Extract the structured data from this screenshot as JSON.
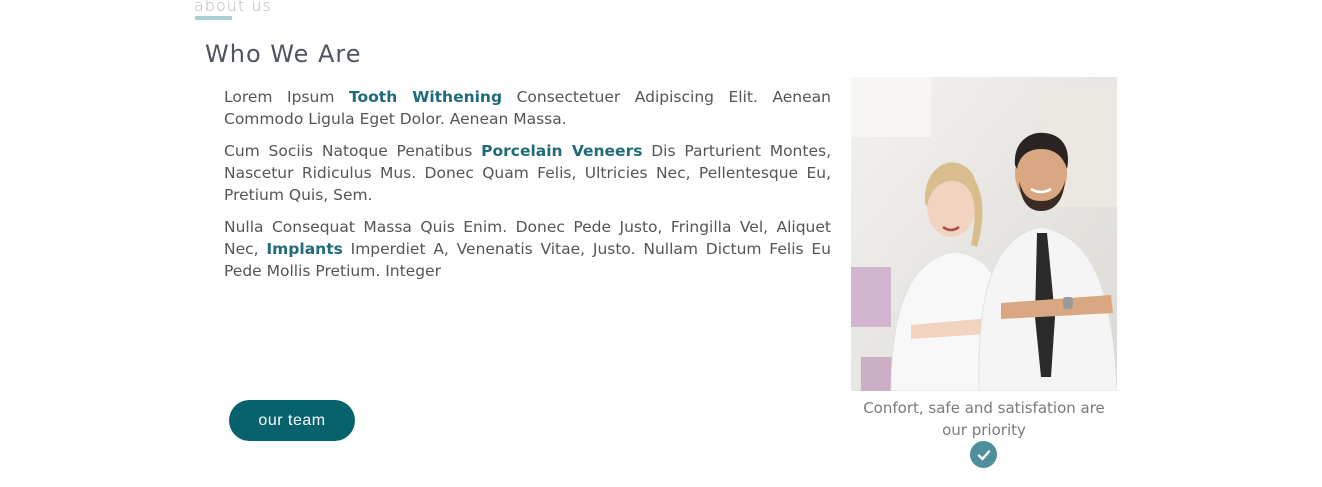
{
  "section": {
    "eyebrow": "about us",
    "title": "Who We Are"
  },
  "paragraphs": [
    {
      "before": "Lorem Ipsum ",
      "keyword": "Tooth Withening",
      "after": " Consectetuer Adipiscing Elit. Aenean Commodo Ligula Eget Dolor. Aenean Massa."
    },
    {
      "before": "Cum Sociis Natoque Penatibus ",
      "keyword": "Porcelain Veneers",
      "after": " Dis Parturient Montes, Nascetur Ridiculus Mus. Donec Quam Felis, Ultricies Nec, Pellentesque Eu, Pretium Quis, Sem."
    },
    {
      "before": "Nulla Consequat Massa Quis Enim. Donec Pede Justo, Fringilla Vel, Aliquet Nec, ",
      "keyword": "Implants",
      "after": " Imperdiet A, Venenatis Vitae, Justo. Nullam Dictum Felis Eu Pede Mollis Pretium. Integer"
    }
  ],
  "button": {
    "label": "our team"
  },
  "figure": {
    "caption": "Confort, safe and satisfation are our priority",
    "check_icon": "check-icon"
  },
  "colors": {
    "accent": "#08626d",
    "keyword": "#1f6b7a",
    "eyebrow_bar": "#a8cfd5",
    "check_bg": "#4f8e9b"
  }
}
